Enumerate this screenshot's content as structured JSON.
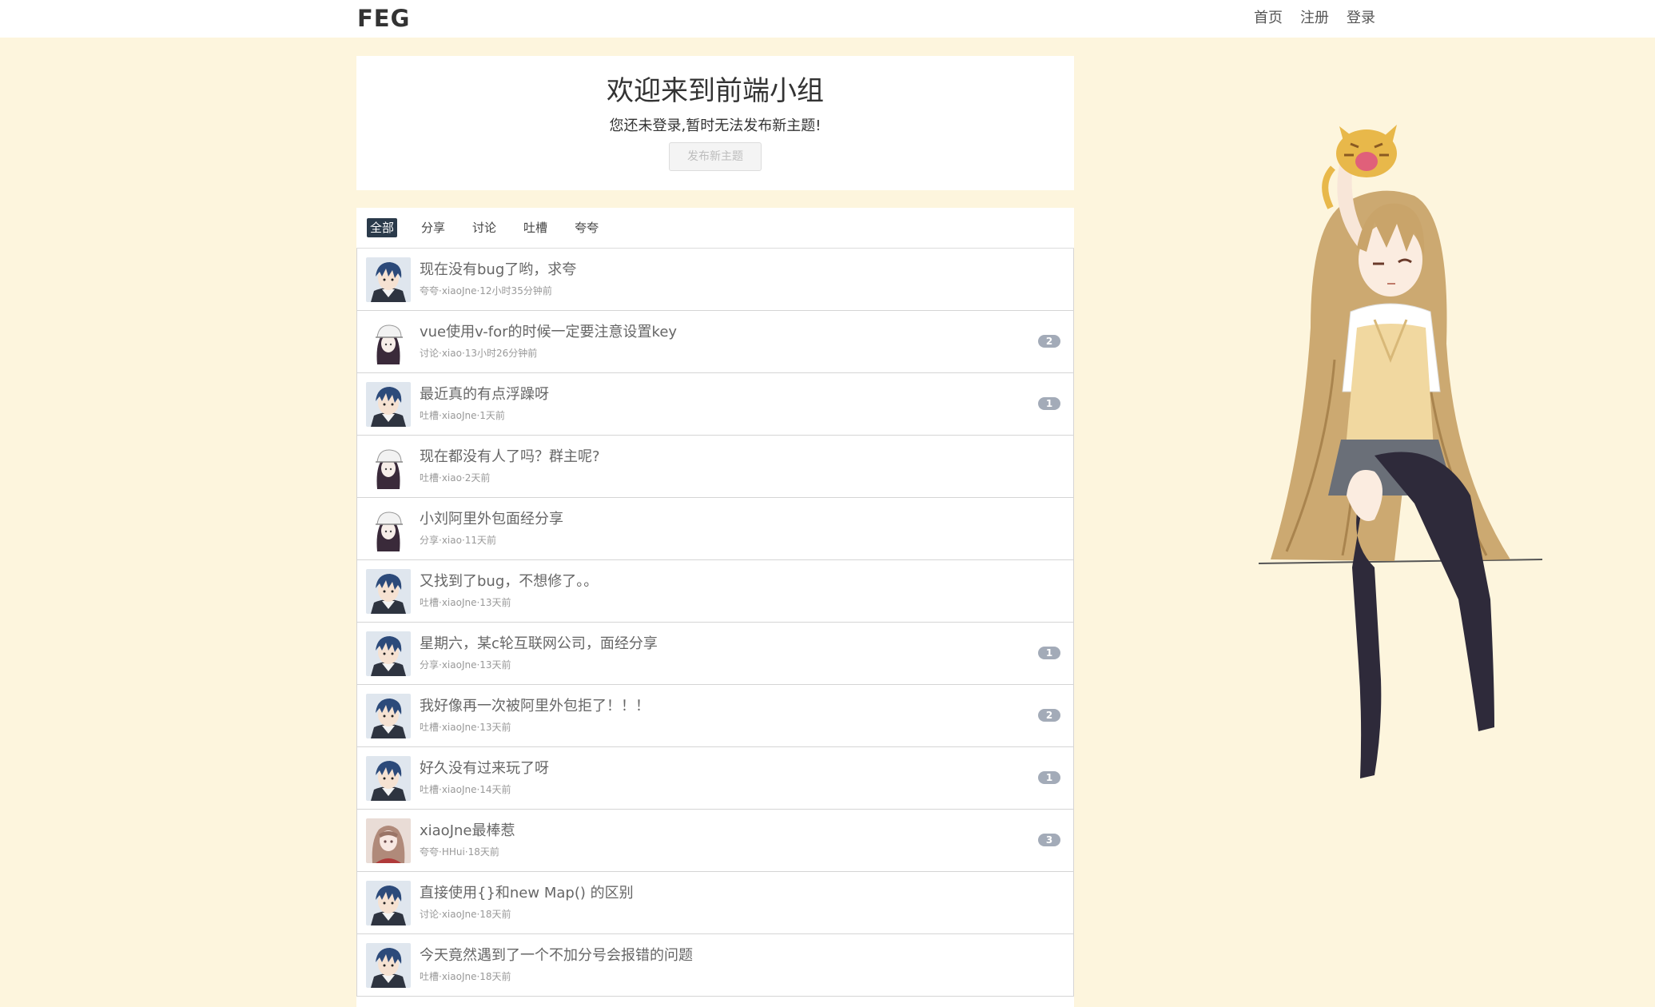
{
  "navbar": {
    "brand": "FEG",
    "links": [
      "首页",
      "注册",
      "登录"
    ]
  },
  "welcome": {
    "title": "欢迎来到前端小组",
    "message": "您还未登录,暂时无法发布新主题!",
    "post_button": "发布新主题"
  },
  "tabs": [
    "全部",
    "分享",
    "讨论",
    "吐槽",
    "夸夸"
  ],
  "active_tab": "全部",
  "topics": [
    {
      "title": "现在没有bug了哟，求夸",
      "meta": "夸夸·xiaoJne·12小时35分钟前",
      "replies": "",
      "avatar": "boy-avatar"
    },
    {
      "title": "vue使用v-for的时候一定要注意设置key",
      "meta": "讨论·xiao·13小时26分钟前",
      "replies": "2",
      "avatar": "girl-cap-avatar"
    },
    {
      "title": "最近真的有点浮躁呀",
      "meta": "吐槽·xiaoJne·1天前",
      "replies": "1",
      "avatar": "boy-avatar"
    },
    {
      "title": "现在都没有人了吗？群主呢?",
      "meta": "吐槽·xiao·2天前",
      "replies": "",
      "avatar": "girl-cap-avatar"
    },
    {
      "title": "小刘阿里外包面经分享",
      "meta": "分享·xiao·11天前",
      "replies": "",
      "avatar": "girl-cap-avatar"
    },
    {
      "title": "又找到了bug，不想修了。。",
      "meta": "吐槽·xiaoJne·13天前",
      "replies": "",
      "avatar": "boy-avatar"
    },
    {
      "title": "星期六，某c轮互联网公司，面经分享",
      "meta": "分享·xiaoJne·13天前",
      "replies": "1",
      "avatar": "boy-avatar"
    },
    {
      "title": "我好像再一次被阿里外包拒了！！！",
      "meta": "吐槽·xiaoJne·13天前",
      "replies": "2",
      "avatar": "boy-avatar"
    },
    {
      "title": "好久没有过来玩了呀",
      "meta": "吐槽·xiaoJne·14天前",
      "replies": "1",
      "avatar": "boy-avatar"
    },
    {
      "title": "xiaoJne最棒惹",
      "meta": "夸夸·HHui·18天前",
      "replies": "3",
      "avatar": "pink-girl-avatar"
    },
    {
      "title": "直接使用{}和new Map() 的区别",
      "meta": "讨论·xiaoJne·18天前",
      "replies": "",
      "avatar": "boy-avatar"
    },
    {
      "title": "今天竟然遇到了一个不加分号会报错的问题",
      "meta": "吐槽·xiaoJne·18天前",
      "replies": "",
      "avatar": "boy-avatar"
    }
  ],
  "mascot": "anime-girl-with-tiger-illustration",
  "colors": {
    "page_bg": "#fdf5dd",
    "badge_bg": "#a3abb8",
    "active_tab_bg": "#2a3a4a"
  }
}
